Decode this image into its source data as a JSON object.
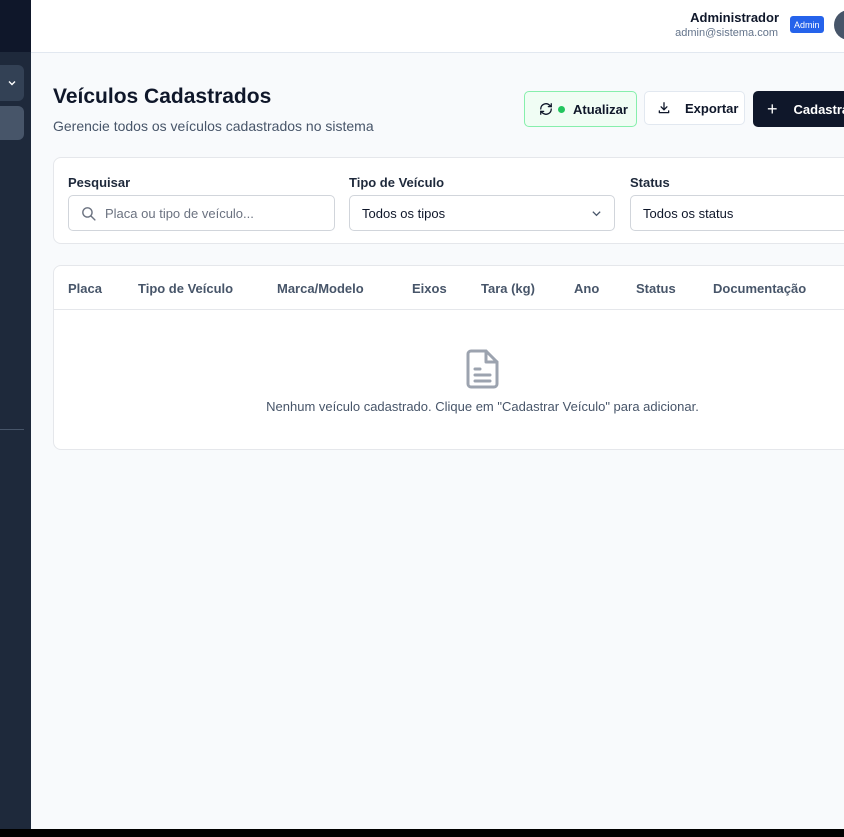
{
  "header": {
    "user_name": "Administrador",
    "user_email": "admin@sistema.com",
    "role_badge": "Admin"
  },
  "page": {
    "title": "Veículos Cadastrados",
    "subtitle": "Gerencie todos os veículos cadastrados no sistema"
  },
  "toolbar": {
    "refresh_label": "Atualizar",
    "export_label": "Exportar",
    "add_label": "Cadastrar Veículo",
    "add_visible_label": "Cadastra"
  },
  "filters": {
    "search_label": "Pesquisar",
    "search_placeholder": "Placa ou tipo de veículo...",
    "type_label": "Tipo de Veículo",
    "type_value": "Todos os tipos",
    "status_label": "Status",
    "status_value": "Todos os status"
  },
  "table": {
    "columns": [
      "Placa",
      "Tipo de Veículo",
      "Marca/Modelo",
      "Eixos",
      "Tara (kg)",
      "Ano",
      "Status",
      "Documentação"
    ],
    "empty_message": "Nenhum veículo cadastrado. Clique em \"Cadastrar Veículo\" para adicionar."
  },
  "colors": {
    "sidebar": "#1e293b",
    "primary_button": "#0f172a",
    "status_dot": "#22c55e",
    "badge": "#2563eb"
  },
  "icons": [
    "chevron-down-icon",
    "refresh-icon",
    "download-icon",
    "plus-icon",
    "search-icon",
    "document-icon"
  ]
}
